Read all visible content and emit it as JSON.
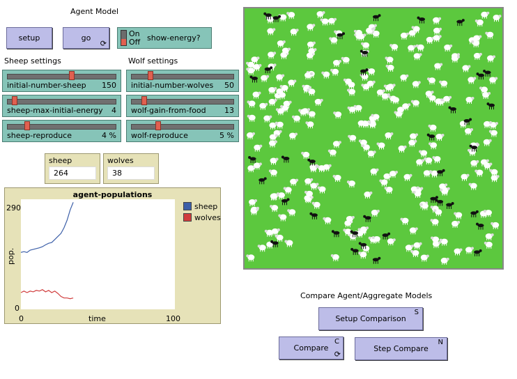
{
  "title": "Agent Model",
  "buttons": {
    "setup": "setup",
    "go": "go",
    "setup_comparison": "Setup Comparison",
    "setup_comparison_key": "S",
    "compare": "Compare",
    "compare_key": "C",
    "step_compare": "Step Compare",
    "step_compare_key": "N"
  },
  "switch": {
    "on_label": "On",
    "off_label": "Off",
    "name": "show-energy?"
  },
  "sheep_settings": {
    "heading": "Sheep settings",
    "sliders": [
      {
        "name": "initial-number-sheep",
        "value": "150",
        "level": 0.6
      },
      {
        "name": "sheep-max-initial-energy",
        "value": "4",
        "level": 0.05
      },
      {
        "name": "sheep-reproduce",
        "value": "4 %",
        "level": 0.17
      }
    ]
  },
  "wolf_settings": {
    "heading": "Wolf settings",
    "sliders": [
      {
        "name": "initial-number-wolves",
        "value": "50",
        "level": 0.17
      },
      {
        "name": "wolf-gain-from-food",
        "value": "13",
        "level": 0.11
      },
      {
        "name": "wolf-reproduce",
        "value": "5 %",
        "level": 0.25
      }
    ]
  },
  "monitors": {
    "sheep": {
      "label": "sheep",
      "value": "264"
    },
    "wolves": {
      "label": "wolves",
      "value": "38"
    }
  },
  "compare_heading": "Compare Agent/Aggregate Models",
  "colors": {
    "sheep": "#3c5fa8",
    "wolves": "#d03c3c",
    "grass": "#5cc83e"
  },
  "chart_data": {
    "type": "line",
    "title": "agent-populations",
    "xlabel": "time",
    "ylabel": "pop.",
    "xlim": [
      0,
      100
    ],
    "ylim": [
      0,
      290
    ],
    "x_ticks": [
      "0",
      "100"
    ],
    "y_ticks": [
      "0",
      "290"
    ],
    "legend": "top-right",
    "series": [
      {
        "name": "sheep",
        "color": "#3c5fa8",
        "x": [
          0,
          2,
          4,
          6,
          8,
          10,
          12,
          14,
          16,
          18,
          20,
          22,
          24,
          26,
          28,
          30,
          32,
          34
        ],
        "y": [
          150,
          152,
          150,
          156,
          158,
          160,
          162,
          165,
          170,
          174,
          176,
          184,
          192,
          200,
          215,
          235,
          262,
          282
        ]
      },
      {
        "name": "wolves",
        "color": "#d03c3c",
        "x": [
          0,
          2,
          4,
          6,
          8,
          10,
          12,
          14,
          16,
          18,
          20,
          22,
          24,
          26,
          28,
          30,
          32,
          34
        ],
        "y": [
          44,
          48,
          44,
          48,
          46,
          50,
          48,
          52,
          46,
          50,
          44,
          48,
          42,
          34,
          30,
          30,
          28,
          30
        ]
      }
    ]
  }
}
